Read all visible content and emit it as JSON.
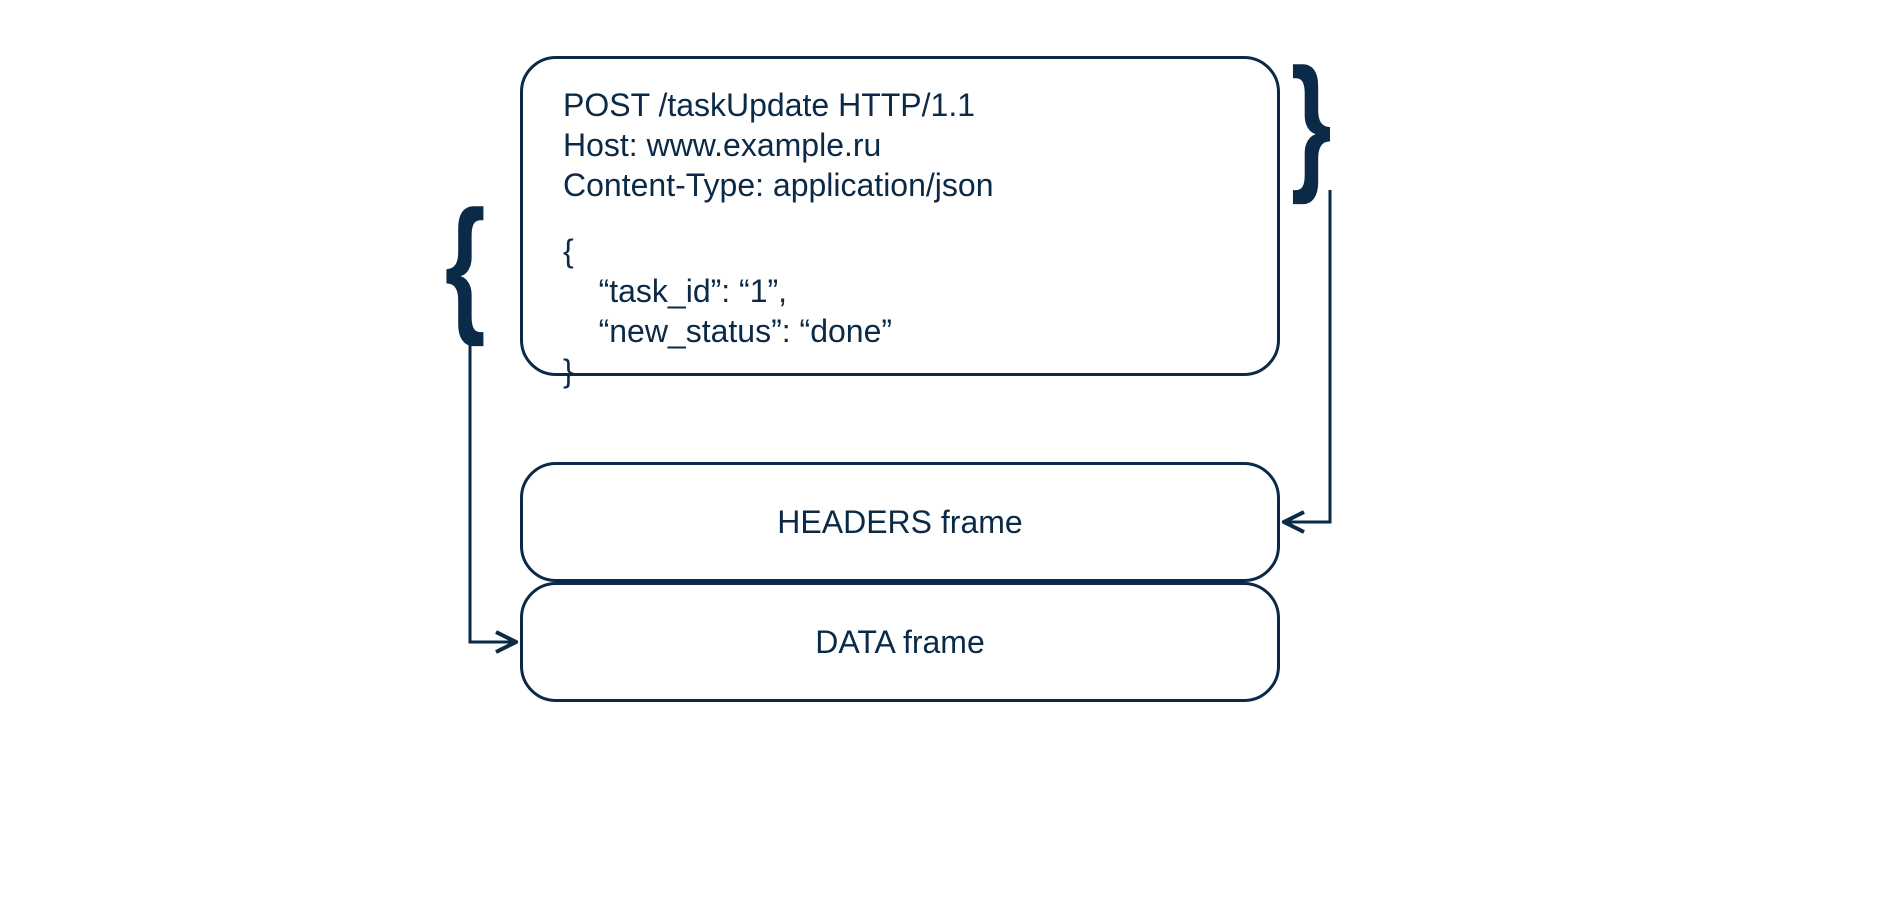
{
  "colors": {
    "ink": "#0b2a47"
  },
  "request": {
    "line1": "POST /taskUpdate HTTP/1.1",
    "line2": "Host: www.example.ru",
    "line3": "Content-Type: application/json",
    "body_open": "{",
    "body_line1": "    “task_id”: “1”,",
    "body_line2": "    “new_status”: “done”",
    "body_close": "}"
  },
  "frames": {
    "headers": "HEADERS frame",
    "data": "DATA frame"
  },
  "braces": {
    "left": "{",
    "right": "}"
  }
}
